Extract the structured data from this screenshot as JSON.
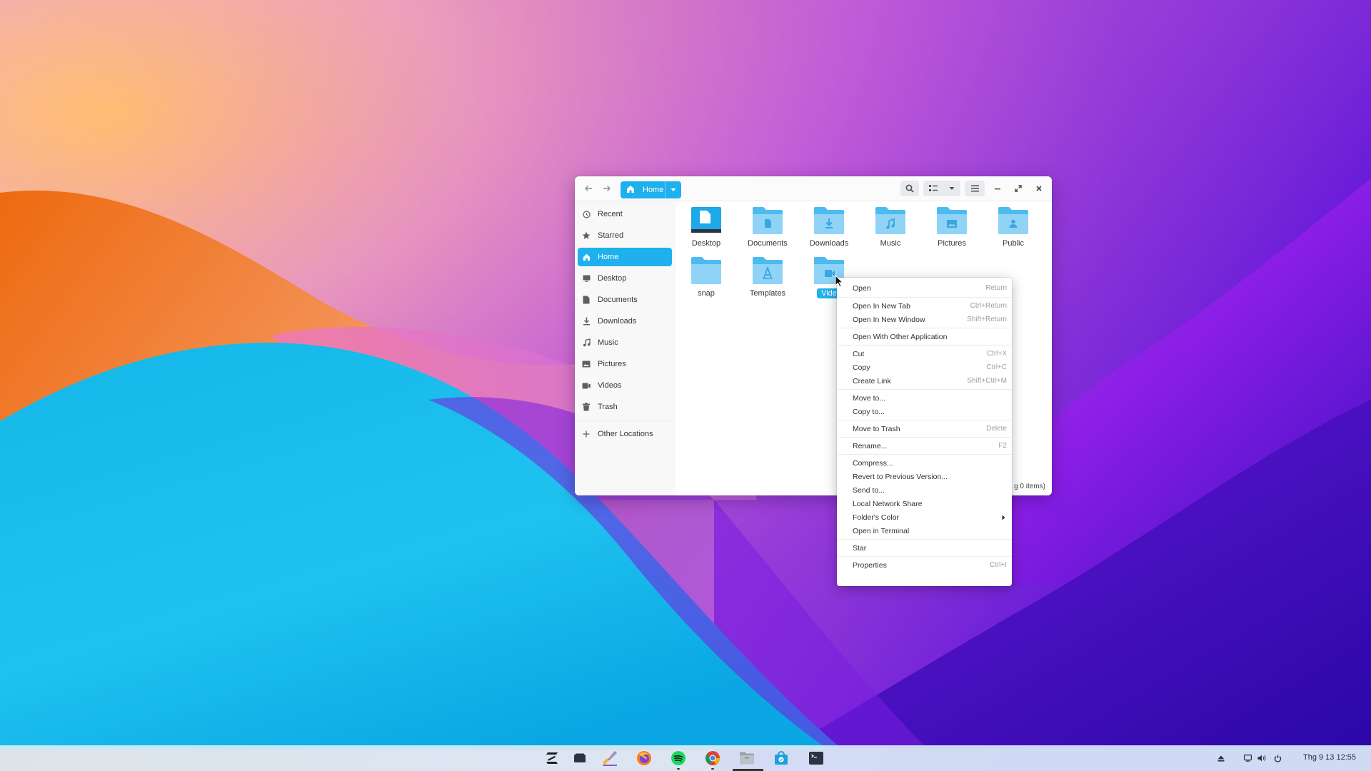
{
  "window": {
    "path_label": "Home",
    "sidebar": [
      {
        "label": "Recent",
        "icon": "clock-icon"
      },
      {
        "label": "Starred",
        "icon": "star-icon"
      },
      {
        "label": "Home",
        "icon": "home-icon",
        "active": true
      },
      {
        "label": "Desktop",
        "icon": "desktop-icon"
      },
      {
        "label": "Documents",
        "icon": "document-icon"
      },
      {
        "label": "Downloads",
        "icon": "download-icon"
      },
      {
        "label": "Music",
        "icon": "music-icon"
      },
      {
        "label": "Pictures",
        "icon": "picture-icon"
      },
      {
        "label": "Videos",
        "icon": "video-icon"
      },
      {
        "label": "Trash",
        "icon": "trash-icon"
      },
      {
        "label": "Other Locations",
        "icon": "plus-icon"
      }
    ],
    "folders": [
      {
        "name": "Desktop",
        "icon": "desktop-folder-icon"
      },
      {
        "name": "Documents",
        "icon": "documents-folder-icon"
      },
      {
        "name": "Downloads",
        "icon": "downloads-folder-icon"
      },
      {
        "name": "Music",
        "icon": "music-folder-icon"
      },
      {
        "name": "Pictures",
        "icon": "pictures-folder-icon"
      },
      {
        "name": "Public",
        "icon": "public-folder-icon"
      },
      {
        "name": "snap",
        "icon": "folder-icon"
      },
      {
        "name": "Templates",
        "icon": "templates-folder-icon"
      },
      {
        "name": "Vide",
        "icon": "videos-folder-icon",
        "selected": true
      }
    ],
    "status_text": "g 0 items)"
  },
  "context_menu": {
    "items": [
      {
        "label": "Open",
        "shortcut": "Return"
      },
      {
        "label": "Open In New Tab",
        "shortcut": "Ctrl+Return"
      },
      {
        "label": "Open In New Window",
        "shortcut": "Shift+Return"
      },
      {
        "label": "Open With Other Application",
        "shortcut": ""
      },
      {
        "label": "Cut",
        "shortcut": "Ctrl+X"
      },
      {
        "label": "Copy",
        "shortcut": "Ctrl+C"
      },
      {
        "label": "Create Link",
        "shortcut": "Shift+Ctrl+M"
      },
      {
        "label": "Move to...",
        "shortcut": ""
      },
      {
        "label": "Copy to...",
        "shortcut": ""
      },
      {
        "label": "Move to Trash",
        "shortcut": "Delete"
      },
      {
        "label": "Rename...",
        "shortcut": "F2"
      },
      {
        "label": "Compress...",
        "shortcut": ""
      },
      {
        "label": "Revert to Previous Version...",
        "shortcut": ""
      },
      {
        "label": "Send to...",
        "shortcut": ""
      },
      {
        "label": "Local Network Share",
        "shortcut": ""
      },
      {
        "label": "Folder's Color",
        "shortcut": "",
        "submenu": true
      },
      {
        "label": "Open in Terminal",
        "shortcut": ""
      },
      {
        "label": "Star",
        "shortcut": ""
      },
      {
        "label": "Properties",
        "shortcut": "Ctrl+I"
      }
    ]
  },
  "taskbar": {
    "apps": [
      {
        "name": "zorin-menu-icon"
      },
      {
        "name": "workspaces-icon"
      },
      {
        "name": "brush-app-icon"
      },
      {
        "name": "firefox-icon"
      },
      {
        "name": "spotify-icon"
      },
      {
        "name": "chrome-icon"
      },
      {
        "name": "files-icon"
      },
      {
        "name": "software-store-icon"
      },
      {
        "name": "terminal-icon"
      }
    ],
    "clock": "Thg 9 13  12:55"
  },
  "colors": {
    "accent": "#1fb1ee",
    "folder_light": "#8fd3f6",
    "folder_dark": "#4dbbef"
  }
}
